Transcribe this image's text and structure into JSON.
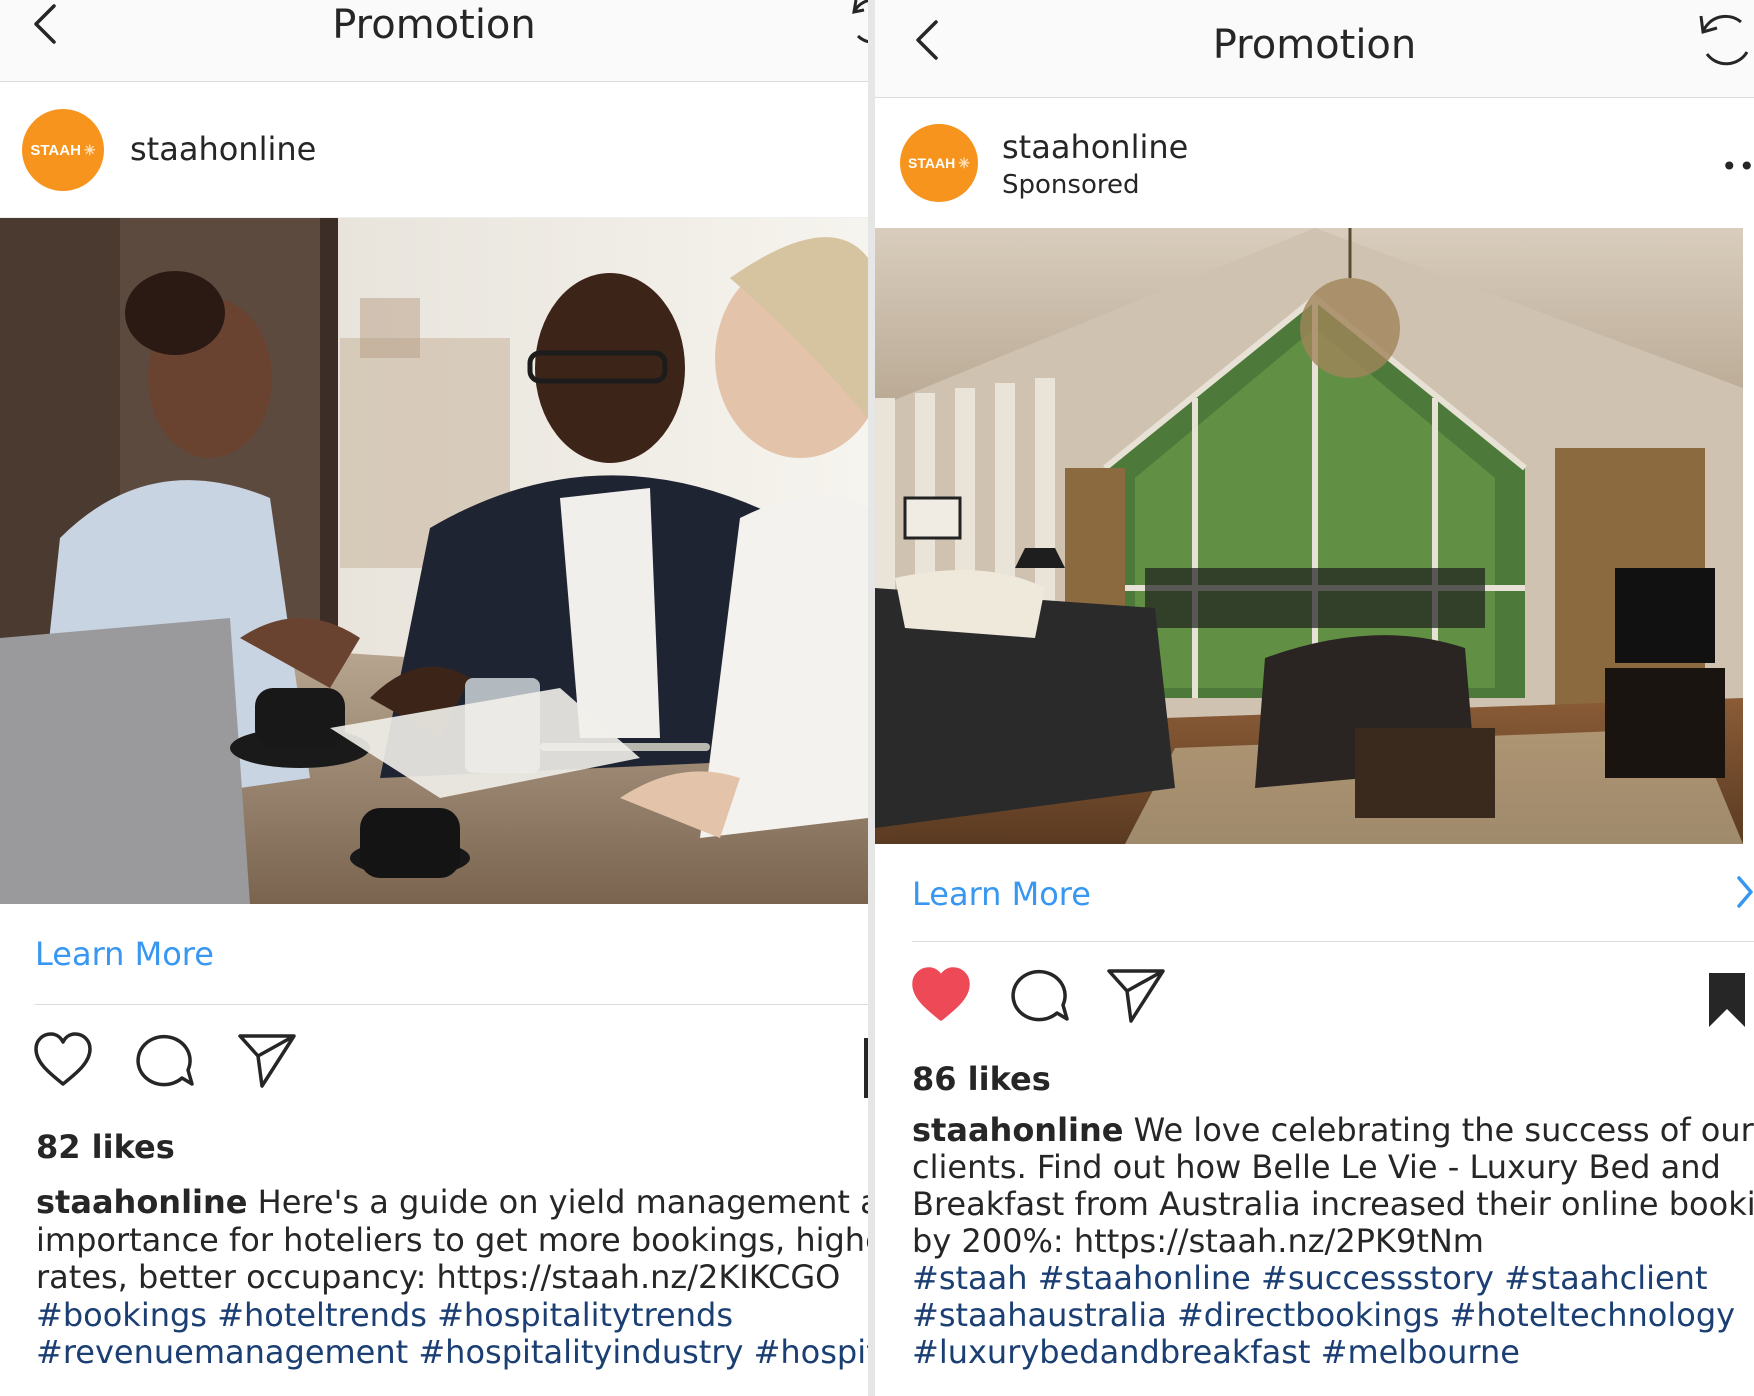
{
  "left_post": {
    "topbar": {
      "title": "Promotion"
    },
    "account": {
      "username": "staahonline",
      "avatar_text": "STAAH"
    },
    "cta": {
      "label": "Learn More"
    },
    "likes": "82 likes",
    "caption": {
      "username": "staahonline",
      "lines": [
        "Here's a guide on yield management and",
        "importance for hoteliers to get more bookings, higher",
        "rates, better occupancy: https://staah.nz/2KIKCGO"
      ],
      "hashtag_lines": [
        "#bookings #hoteltrends #hospitalitytrends",
        "#revenuemanagement #hospitalityindustry #hospitalit"
      ]
    }
  },
  "right_post": {
    "topbar": {
      "title": "Promotion"
    },
    "account": {
      "username": "staahonline",
      "sponsored": "Sponsored",
      "avatar_text": "STAAH",
      "more": "••"
    },
    "cta": {
      "label": "Learn More"
    },
    "likes": "86 likes",
    "caption": {
      "username": "staahonline",
      "lines": [
        "We love celebrating the success of our",
        "clients. Find out how Belle Le Vie - Luxury Bed and",
        "Breakfast from Australia increased their online bookings",
        "by 200%: https://staah.nz/2PK9tNm"
      ],
      "hashtag_lines": [
        "#staah #staahonline #successstory #staahclient",
        "#staahaustralia #directbookings #hoteltechnology",
        "#luxurybedandbreakfast #melbourne"
      ]
    }
  },
  "colors": {
    "brand_orange": "#f7941d",
    "link_blue": "#3897f0",
    "liked_red": "#ed4956",
    "hashtag": "#1b3f73"
  },
  "icons": [
    "back-icon",
    "refresh-icon",
    "heart-icon",
    "comment-icon",
    "share-icon",
    "bookmark-icon",
    "chevron-right-icon",
    "more-icon"
  ]
}
